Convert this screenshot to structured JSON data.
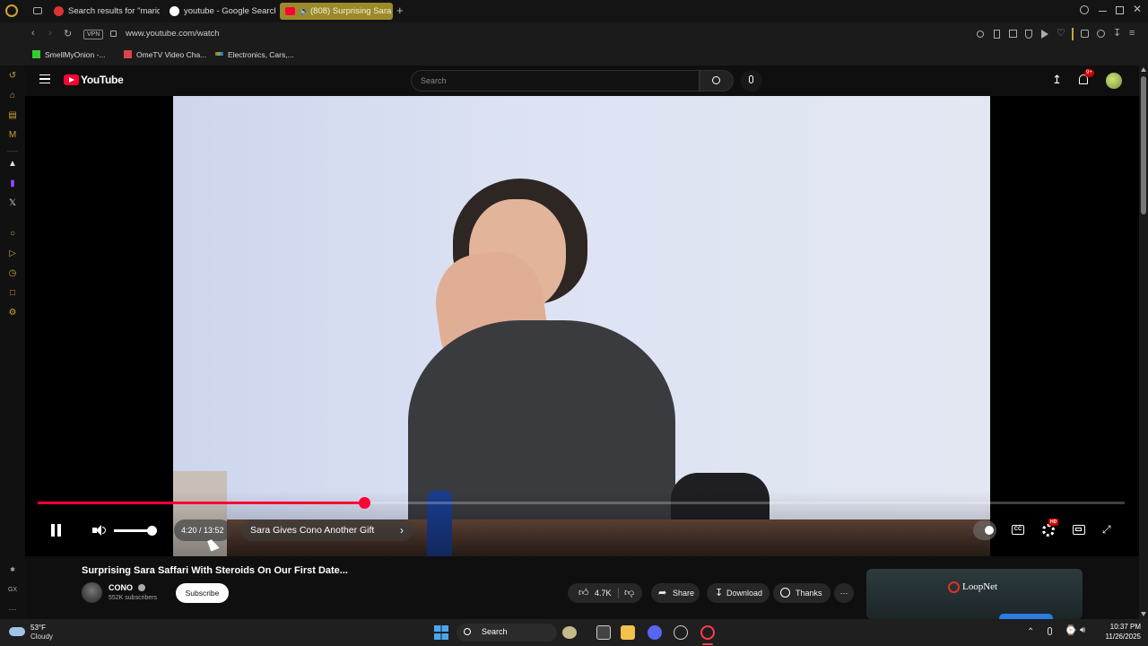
{
  "browser": {
    "tabs": [
      {
        "title": "Search results for \"mario",
        "active": false
      },
      {
        "title": "youtube - Google Search",
        "active": false
      },
      {
        "title": "(808) Surprising Sara",
        "active": true
      }
    ],
    "vpn_label": "VPN",
    "url": "www.youtube.com/watch",
    "bookmarks": [
      "SmellMyOnion -...",
      "OmeTV Video Cha...",
      "Electronics, Cars,..."
    ]
  },
  "youtube": {
    "logo_text": "YouTube",
    "search_placeholder": "Search",
    "notifications_badge": "9+"
  },
  "player": {
    "time_display": "4:20 / 13:52",
    "chapter_title": "Sara Gives Cono Another Gift",
    "progress_fraction": 0.3,
    "volume_fraction": 1.0,
    "hd_badge": "HD"
  },
  "video_info": {
    "title": "Surprising Sara Saffari With Steroids On Our First Date...",
    "channel_name": "CONO",
    "subscribers": "552K subscribers",
    "subscribe_label": "Subscribe",
    "likes": "4.7K",
    "share_label": "Share",
    "download_label": "Download",
    "thanks_label": "Thanks"
  },
  "ad": {
    "brand": "LoopNet"
  },
  "taskbar": {
    "temperature": "53°F",
    "weather": "Cloudy",
    "search_label": "Search",
    "time": "10:37 PM",
    "date": "11/26/2025"
  },
  "colors": {
    "youtube_red": "#ff0033",
    "active_tab": "#9c8a2a",
    "opera_accent": "#c9a23a"
  }
}
